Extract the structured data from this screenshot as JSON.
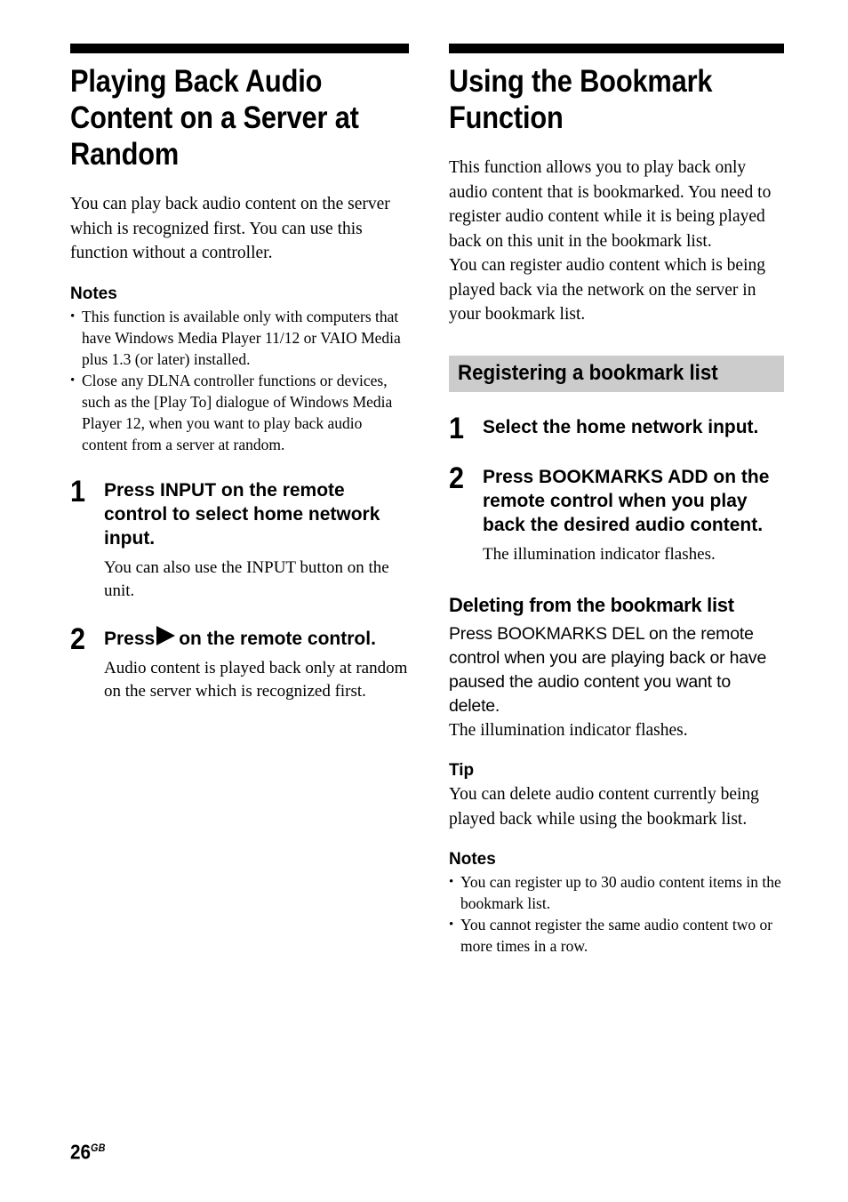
{
  "page": {
    "number": "26",
    "region_code": "GB"
  },
  "left_column": {
    "chapter_title": "Playing Back Audio Content on a Server at Random",
    "intro": "You can play back audio content on the server which is recognized first. You can use this function without a controller.",
    "notes_heading": "Notes",
    "notes": [
      "This function is available only with computers that have Windows Media Player 11/12 or VAIO Media plus 1.3 (or later) installed.",
      "Close any DLNA controller functions or devices, such as the [Play To] dialogue of Windows Media Player 12, when you want to play back audio content from a server at random."
    ],
    "steps": [
      {
        "number": "1",
        "title_before_icon": "Press INPUT on the remote control to select home network input.",
        "icon": "",
        "title_after_icon": "",
        "description": "You can also use the INPUT button on the unit."
      },
      {
        "number": "2",
        "title_before_icon": "Press",
        "icon": "play-arrow-icon",
        "title_after_icon": "on the remote control.",
        "description": "Audio content is played back only at random on the server which is recognized first."
      }
    ]
  },
  "right_column": {
    "chapter_title": "Using the Bookmark Function",
    "intro_paragraph_1": "This function allows you to play back only audio content that is bookmarked. You need to register audio content while it is being played back on this unit in the bookmark list.",
    "intro_paragraph_2": "You can register audio content which is being played back via the network on the server in your bookmark list.",
    "section_bar_label": "Registering a bookmark list",
    "section_bar_color": "#cccccc",
    "steps": [
      {
        "number": "1",
        "title": "Select the home network input.",
        "description": ""
      },
      {
        "number": "2",
        "title": "Press BOOKMARKS ADD on the remote control when you play back the desired audio content.",
        "description": "The illumination indicator flashes."
      }
    ],
    "deleting_heading": "Deleting from the bookmark list",
    "deleting_body": "Press BOOKMARKS DEL on the remote control when you are playing back or have paused the audio content you want to delete.",
    "deleting_result": "The illumination indicator flashes.",
    "tip_heading": "Tip",
    "tip_body": "You can delete audio content currently being played back while using the bookmark list.",
    "notes_heading": "Notes",
    "notes": [
      "You can register up to 30 audio content items in the bookmark list.",
      "You cannot register the same audio content two or more times in a row."
    ]
  }
}
